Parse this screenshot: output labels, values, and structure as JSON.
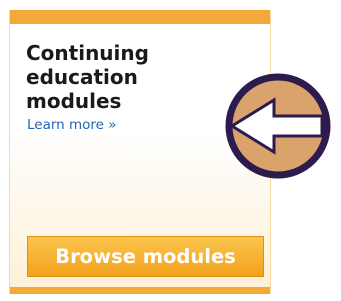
{
  "card": {
    "title": "Continuing\neducation\nmodules",
    "learn_more_label": "Learn more",
    "learn_more_suffix": "»",
    "browse_button_label": "Browse modules"
  },
  "icons": {
    "arrow": "arrow-left-icon"
  },
  "colors": {
    "accent_orange": "#f3a83a",
    "button_top": "#fbc54d",
    "button_bottom": "#f2a21c",
    "link_blue": "#2566b0",
    "arrow_ring": "#2d1b4e",
    "arrow_fill": "#d9a36b"
  }
}
